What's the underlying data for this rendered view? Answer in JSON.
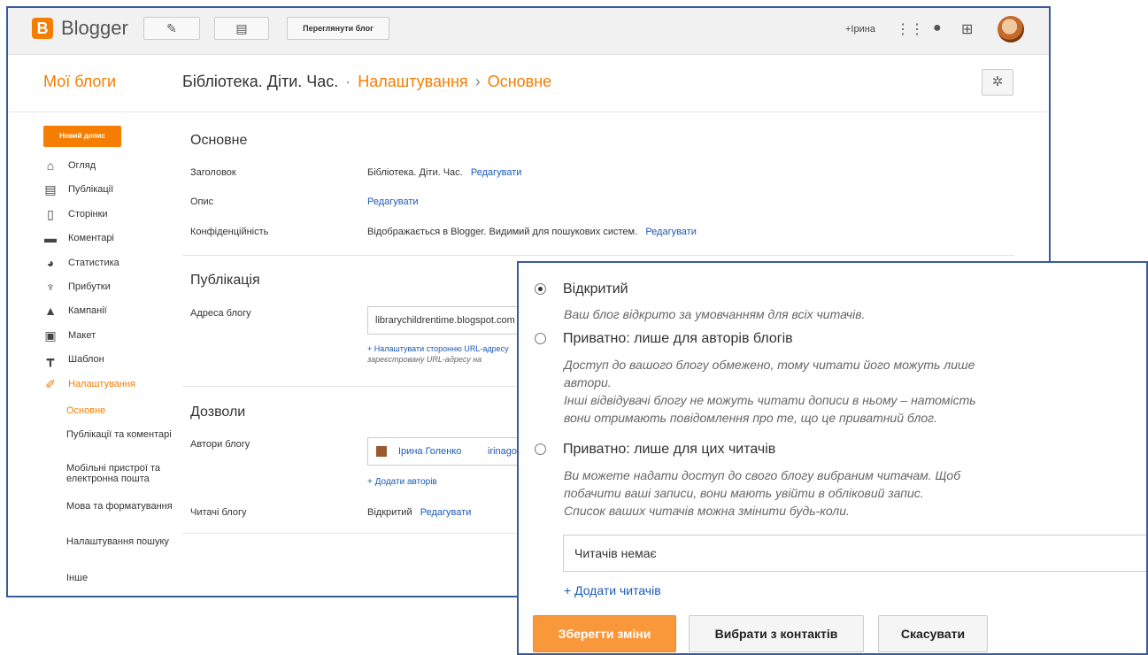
{
  "app": {
    "logo_text": "Blogger",
    "view_blog_button": "Переглянути блог",
    "user": "+Ірина"
  },
  "header": {
    "my_blogs": "Мої блоги",
    "breadcrumb": {
      "blog": "Бібліотека. Діти. Час.",
      "dot": "·",
      "settings": "Налаштування",
      "arrow": "›",
      "current": "Основне"
    }
  },
  "sidebar": {
    "new_post": "Новий допис",
    "items": [
      {
        "label": "Огляд",
        "icon": "home-icon"
      },
      {
        "label": "Публікації",
        "icon": "posts-icon"
      },
      {
        "label": "Сторінки",
        "icon": "pages-icon"
      },
      {
        "label": "Коментарі",
        "icon": "comments-icon"
      },
      {
        "label": "Статистика",
        "icon": "stats-icon"
      },
      {
        "label": "Прибутки",
        "icon": "trophy-icon"
      },
      {
        "label": "Кампанії",
        "icon": "campaigns-icon"
      },
      {
        "label": "Макет",
        "icon": "layout-icon"
      },
      {
        "label": "Шаблон",
        "icon": "template-icon"
      },
      {
        "label": "Налаштування",
        "icon": "wrench-icon"
      }
    ],
    "sub_items": [
      "Основне",
      "Публікації та коментарі",
      "Мобільні пристрої та електронна пошта",
      "Мова та форматування",
      "Налаштування пошуку",
      "Інше"
    ]
  },
  "main": {
    "basic": {
      "title": "Основне",
      "title_label": "Заголовок",
      "title_value": "Бібліотека. Діти. Час.",
      "desc_label": "Опис",
      "privacy_label": "Конфіденційність",
      "privacy_value": "Відображається в Blogger. Видимий для пошукових систем.",
      "edit": "Редагувати"
    },
    "publishing": {
      "title": "Публікація",
      "address_label": "Адреса блогу",
      "address_value": "librarychildrentime.blogspot.com",
      "custom_url_link": "+ Налаштувати сторонню URL-адресу",
      "custom_url_note": "зареєстровану URL-адресу на"
    },
    "permissions": {
      "title": "Дозволи",
      "authors_label": "Автори блогу",
      "author_name": "Ірина Голенко",
      "author_email": "irinagolenko",
      "add_authors": "+ Додати авторів",
      "readers_label": "Читачі блогу",
      "readers_value": "Відкритий",
      "edit": "Редагувати"
    }
  },
  "popup": {
    "options": [
      {
        "label": "Відкритий",
        "selected": true,
        "desc": [
          "Ваш блог відкрито за умовчанням для всіх читачів."
        ]
      },
      {
        "label": "Приватно: лише для авторів блогів",
        "selected": false,
        "desc": [
          "Доступ до вашого блогу обмежено, тому читати його можуть лише",
          "автори.",
          "Інші відвідувачі блогу не можуть читати дописи в ньому – натомість",
          "вони отримають повідомлення про те, що це приватний блог."
        ]
      },
      {
        "label": "Приватно: лише для цих читачів",
        "selected": false,
        "desc": [
          "Ви можете надати доступ до свого блогу вибраним читачам. Щоб",
          "побачити ваші записи, вони мають увійти в обліковий запис.",
          "Список ваших читачів можна змінити будь-коли."
        ]
      }
    ],
    "readers_placeholder": "Читачів немає",
    "add_readers": "+ Додати читачів",
    "save": "Зберегти зміни",
    "choose_contacts": "Вибрати з контактів",
    "cancel": "Скасувати"
  }
}
